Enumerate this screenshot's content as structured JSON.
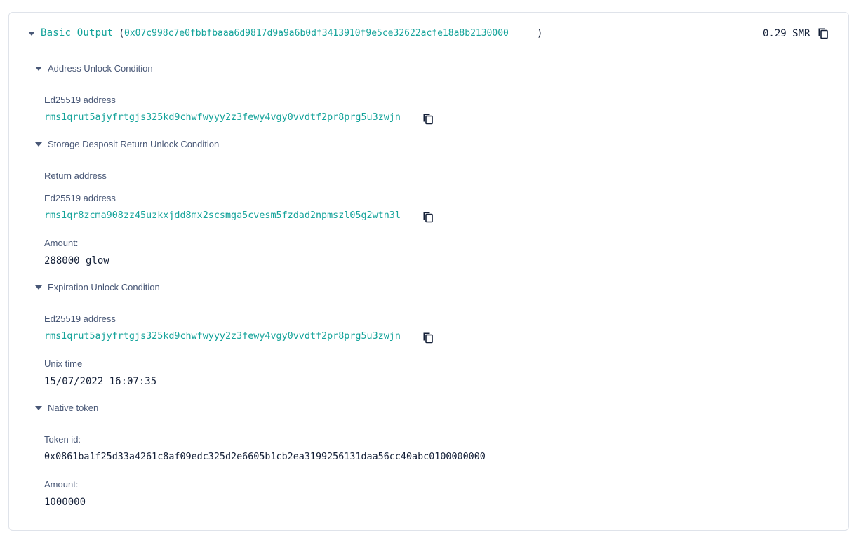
{
  "output": {
    "title": "Basic Output",
    "open_paren": "(",
    "output_id": "0x07c998c7e0fbbfbaaa6d9817d9a9a6b0df3413910f9e5ce32622acfe18a8b2130000",
    "close_paren": ")",
    "amount": "0.29 SMR"
  },
  "address_unlock": {
    "title": "Address Unlock Condition",
    "address_label": "Ed25519 address",
    "address": "rms1qrut5ajyfrtgjs325kd9chwfwyyy2z3fewy4vgy0vvdtf2pr8prg5u3zwjn"
  },
  "storage_deposit_return": {
    "title": "Storage Desposit Return Unlock Condition",
    "return_address_label": "Return address",
    "address_label": "Ed25519 address",
    "address": "rms1qr8zcma908zz45uzkxjdd8mx2scsmga5cvesm5fzdad2npmszl05g2wtn3l",
    "amount_label": "Amount:",
    "amount": "288000 glow"
  },
  "expiration_unlock": {
    "title": "Expiration Unlock Condition",
    "address_label": "Ed25519 address",
    "address": "rms1qrut5ajyfrtgjs325kd9chwfwyyy2z3fewy4vgy0vvdtf2pr8prg5u3zwjn",
    "unix_time_label": "Unix time",
    "unix_time": "15/07/2022 16:07:35"
  },
  "native_token": {
    "title": "Native token",
    "token_id_label": "Token id:",
    "token_id": "0x0861ba1f25d33a4261c8af09edc325d2e6605b1cb2ea3199256131daa56cc40abc0100000000",
    "amount_label": "Amount:",
    "amount": "1000000"
  },
  "icons": {
    "copy": "copy-icon",
    "expand": "caret-down-icon"
  },
  "colors": {
    "accent": "#14a39a",
    "text_dark": "#131f37",
    "text_muted": "#485776",
    "border": "#dfe3ea"
  }
}
